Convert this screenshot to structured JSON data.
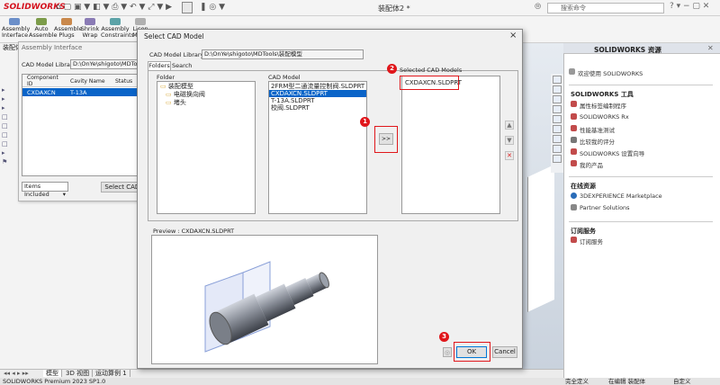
{
  "app": {
    "brand": "SOLIDWORKS",
    "doc_title": "装配体2 *",
    "search_placeholder": "搜索命令",
    "status_left": "SOLIDWORKS Premium 2023 SP1.0",
    "status_right_1": "完全定义",
    "status_right_2": "在编辑 装配体",
    "status_right_3": "自定义"
  },
  "ribbon": {
    "buttons": [
      {
        "label1": "Assembly",
        "label2": "Interface"
      },
      {
        "label1": "Auto",
        "label2": "Assemble"
      },
      {
        "label1": "Assemble",
        "label2": "Plugs"
      },
      {
        "label1": "Shrink",
        "label2": "Wrap"
      },
      {
        "label1": "Assembly",
        "label2": "Constraints"
      },
      {
        "label1": "Licen",
        "label2": "Mana"
      }
    ]
  },
  "left_tree": {
    "header": "装配体"
  },
  "bottom_tabs": [
    "模型",
    "3D 视图",
    "运动算例 1"
  ],
  "assembly_interface": {
    "title": "Assembly Interface",
    "library_label": "CAD Model Library",
    "library_path": "D:\\OnYe\\shigoto\\MDTools\\装配模",
    "columns": [
      "Component ID",
      "Cavity Name",
      "Status"
    ],
    "rows": [
      {
        "id": "CXDAXCN",
        "cavity": "T-13A",
        "status": ""
      }
    ],
    "items_select": "Items Included",
    "select_btn": "Select CAD M"
  },
  "dialog": {
    "title": "Select CAD Model",
    "library_label": "CAD Model Library",
    "library_path": "D:\\OnYe\\shigoto\\MDTools\\装配模型",
    "tabs": [
      "Folders",
      "Search"
    ],
    "folder_label": "Folder",
    "folders": [
      "装配模型",
      "电磁换向阀",
      "堵头"
    ],
    "cad_label": "CAD Model",
    "cad_models": [
      "2FRM型二通流量控制阀.SLDPRT",
      "CXDAXCN.SLDPRT",
      "T-13A.SLDPRT",
      "校阀.SLDPRT"
    ],
    "selected_cad_index": 1,
    "add_btn": ">>",
    "selected_label": "Selected CAD Models",
    "selected_models": [
      "CXDAXCN.SLDPRT"
    ],
    "preview_label": "Preview : CXDAXCN.SLDPRT",
    "ok_btn": "OK",
    "cancel_btn": "Cancel",
    "small_btn": "◎",
    "close_glyph": "×",
    "badges": [
      "1",
      "2",
      "3"
    ]
  },
  "task_pane": {
    "title": "SOLIDWORKS 资源",
    "welcome": "欢迎使用 SOLIDWORKS",
    "tools_header": "SOLIDWORKS 工具",
    "tools": [
      "属性标签编制程序",
      "SOLIDWORKS Rx",
      "性能基准测试",
      "比较我的评分",
      "SOLIDWORKS 设置向导",
      "我的产品"
    ],
    "online_header": "在线资源",
    "online": [
      "3DEXPERIENCE Marketplace",
      "Partner Solutions"
    ],
    "subscription_header": "订阅服务",
    "subscription": [
      "订阅服务"
    ]
  },
  "colors": {
    "highlight": "#e0161b",
    "selection": "#0a64c8",
    "brand_red": "#d4121e"
  }
}
